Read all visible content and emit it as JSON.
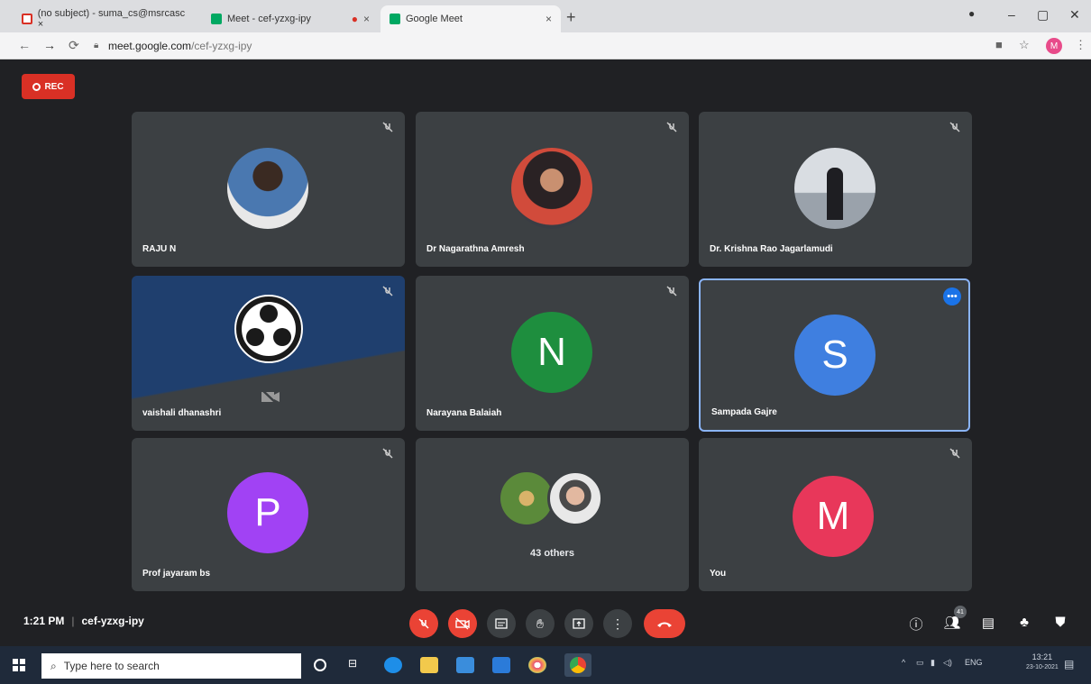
{
  "browser": {
    "tabs": [
      {
        "label": "(no subject) - suma_cs@msrcasc ×",
        "close": "×"
      },
      {
        "label": "Meet - cef-yzxg-ipy",
        "close": "×"
      },
      {
        "label": "Google Meet",
        "close": "×"
      }
    ],
    "new_tab": "+",
    "window_controls": {
      "minimize": "–",
      "maximize": "▢",
      "close": "✕"
    },
    "url_host": "meet.google.com",
    "url_path": "/cef-yzxg-ipy",
    "profile_initial": "M"
  },
  "meet": {
    "rec_label": "REC",
    "participants": [
      {
        "name": "RAJU N",
        "type": "photo"
      },
      {
        "name": "Dr Nagarathna Amresh",
        "type": "photo"
      },
      {
        "name": "Dr. Krishna Rao Jagarlamudi",
        "type": "photo"
      },
      {
        "name": "vaishali dhanashri",
        "type": "obs"
      },
      {
        "name": "Narayana Balaiah",
        "initial": "N",
        "color": "#1e8e3e"
      },
      {
        "name": "Sampada Gajre",
        "initial": "S",
        "color": "#3f7fe0"
      },
      {
        "name": "Prof jayaram bs",
        "initial": "P",
        "color": "#a142f4"
      },
      {
        "name": "43 others",
        "type": "group"
      },
      {
        "name": "You",
        "initial": "M",
        "color": "#e8375a"
      }
    ],
    "more_label": "•••",
    "time": "1:21 PM",
    "code": "cef-yzxg-ipy",
    "people_badge": "41",
    "colors": {
      "accent_red": "#ea4335",
      "bg": "#202124",
      "tile": "#3c4043",
      "selected": "#8ab4f8"
    }
  },
  "taskbar": {
    "search_placeholder": "Type here to search",
    "tray_lang": "ENG",
    "tray_time": "13:21",
    "tray_date": "23-10-2021"
  }
}
